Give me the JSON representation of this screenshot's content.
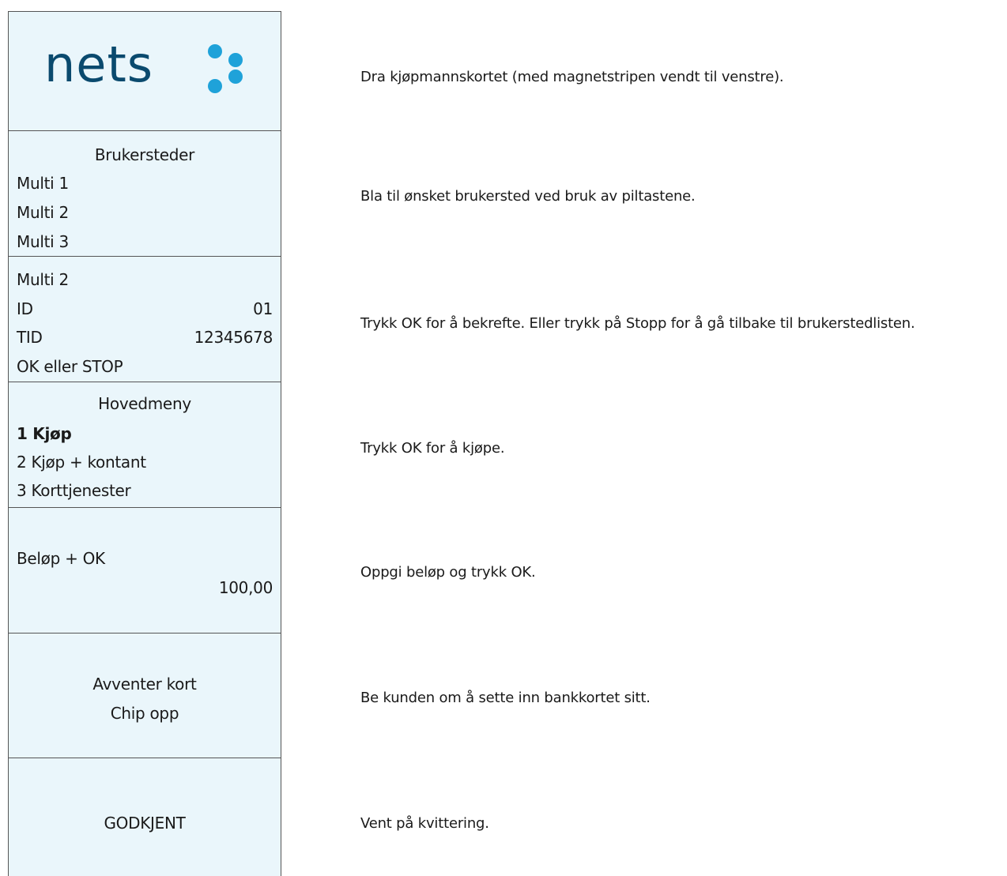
{
  "logo": {
    "text": "nets",
    "accent_color": "#1fa2d9",
    "brand_color": "#0a4a6e"
  },
  "screens": {
    "merchants": {
      "title": "Brukersteder",
      "items": [
        "Multi 1",
        "Multi 2",
        "Multi 3"
      ]
    },
    "confirm": {
      "name": "Multi 2",
      "id_label": "ID",
      "id_value": "01",
      "tid_label": "TID",
      "tid_value": "12345678",
      "prompt": "OK eller STOP"
    },
    "main_menu": {
      "title": "Hovedmeny",
      "items": [
        "1 Kjøp",
        "2 Kjøp + kontant",
        "3 Korttjenester"
      ]
    },
    "amount": {
      "label": "Beløp + OK",
      "value": "100,00"
    },
    "await_card": {
      "line1": "Avventer kort",
      "line2": "Chip opp"
    },
    "approved": {
      "text": "GODKJENT"
    }
  },
  "instructions": [
    "Dra kjøpmannskortet (med magnetstripen vendt til venstre).",
    "Bla til ønsket brukersted ved bruk av piltastene.",
    "Trykk OK for å bekrefte. Eller trykk på Stopp for å gå tilbake til brukerstedlisten.",
    "Trykk OK for å kjøpe.",
    "Oppgi beløp og trykk OK.",
    "Be kunden om å sette inn bankkortet sitt.",
    "Vent på kvittering."
  ],
  "colors": {
    "screen_bg": "#eaf6fb",
    "border": "#555555"
  }
}
